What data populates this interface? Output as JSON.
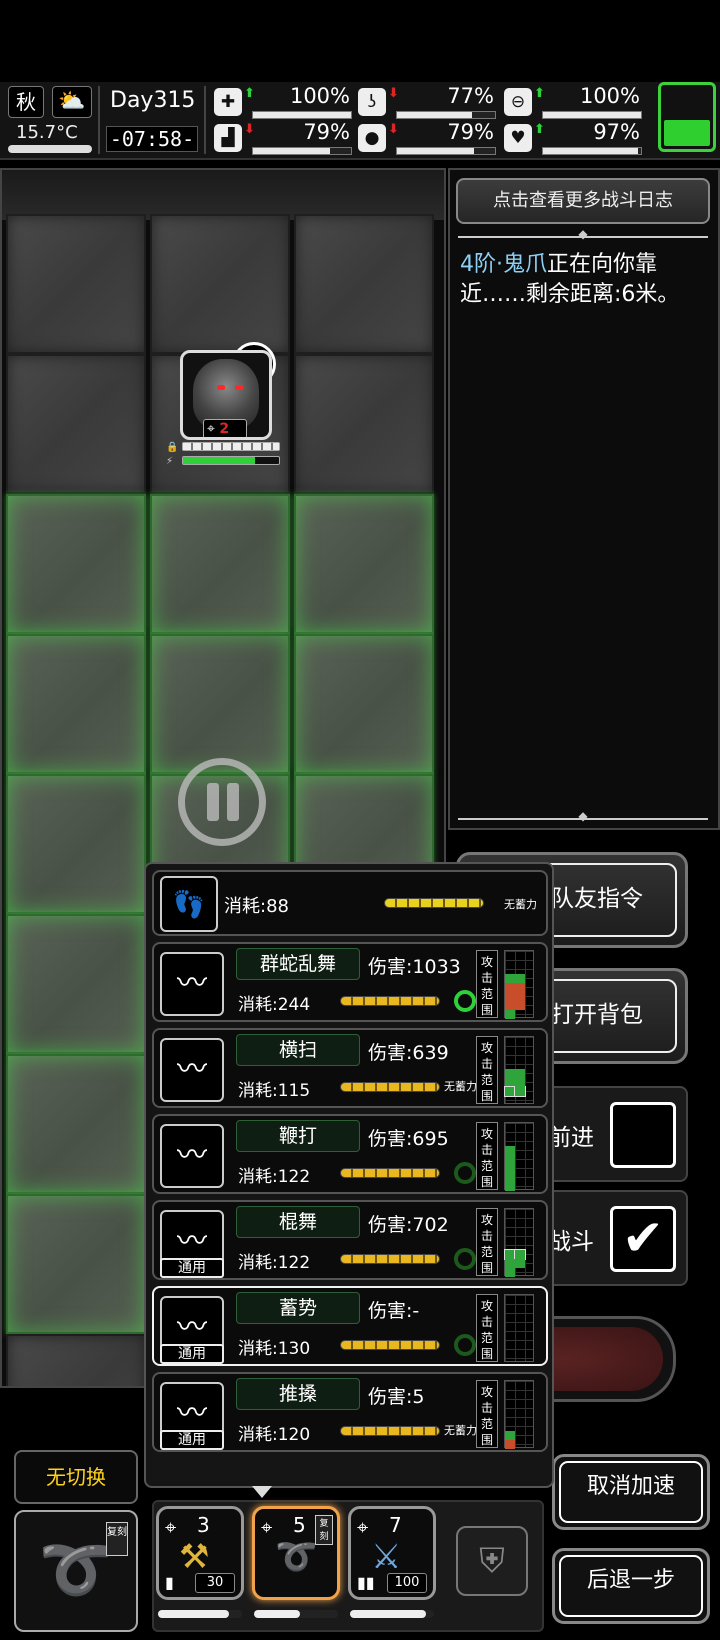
{
  "status": {
    "season": "秋",
    "temperature": "15.7°C",
    "day": "Day315",
    "time": "-07:58-",
    "stats": [
      {
        "icon": "medkit-icon",
        "trend": "up",
        "value": "100%",
        "level": 1.0
      },
      {
        "icon": "stomach-icon",
        "trend": "down",
        "value": "77%",
        "level": 0.77
      },
      {
        "icon": "pill-icon",
        "trend": "up",
        "value": "100%",
        "level": 1.0
      },
      {
        "icon": "boot-icon",
        "trend": "down",
        "value": "79%",
        "level": 0.79
      },
      {
        "icon": "water-drop-icon",
        "trend": "down",
        "value": "79%",
        "level": 0.79
      },
      {
        "icon": "heart-icon",
        "trend": "up",
        "value": "97%",
        "level": 0.97
      }
    ],
    "battery_level": 0.4
  },
  "battle": {
    "enemy_range": "2",
    "enemy_stamina": 0.75
  },
  "log": {
    "button": "点击查看更多战斗日志",
    "enemy_name": "4阶·鬼爪",
    "message": "正在向你靠近……剩余距离:6米。"
  },
  "right_buttons": {
    "team_command": "队友指令",
    "open_bag": "打开背包",
    "advance": "前进",
    "fight": "战斗",
    "fight_checked": "✔",
    "advance_checked": ""
  },
  "skills": {
    "walk": {
      "cost": "消耗:88",
      "no_charge": "无蓄力"
    },
    "range_label": [
      "攻",
      "击",
      "范",
      "围"
    ],
    "general_tag": "通用",
    "list": [
      {
        "name": "群蛇乱舞",
        "damage": "伤害:1033",
        "cost": "消耗:244",
        "no_charge": "",
        "icon": "whip-coil-icon"
      },
      {
        "name": "横扫",
        "damage": "伤害:639",
        "cost": "消耗:115",
        "no_charge": "无蓄力",
        "icon": "sweep-icon"
      },
      {
        "name": "鞭打",
        "damage": "伤害:695",
        "cost": "消耗:122",
        "no_charge": "",
        "icon": "lash-icon"
      },
      {
        "name": "棍舞",
        "damage": "伤害:702",
        "cost": "消耗:122",
        "no_charge": "",
        "icon": "staff-spin-icon"
      },
      {
        "name": "蓄势",
        "damage": "伤害:-",
        "cost": "消耗:130",
        "no_charge": "",
        "icon": "charge-icon"
      },
      {
        "name": "推搡",
        "damage": "伤害:5",
        "cost": "消耗:120",
        "no_charge": "无蓄力",
        "icon": "push-icon"
      }
    ]
  },
  "bottom": {
    "no_switch": "无切换",
    "main_weapon_tag": "复刻",
    "slots": [
      {
        "number": "3",
        "ammo": "30",
        "durability": 0.85
      },
      {
        "number": "5",
        "ammo": "",
        "durability": 0.55
      },
      {
        "number": "7",
        "ammo": "100",
        "durability": 0.9
      }
    ],
    "slot_tag": "复刻",
    "cancel_speed": "取消加速",
    "step_back": "后退一步"
  }
}
